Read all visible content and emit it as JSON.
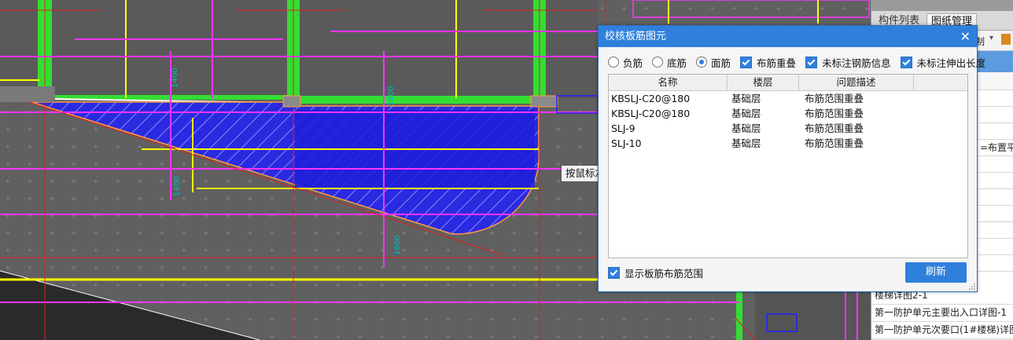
{
  "colors": {
    "cad_background": "#606060",
    "accent": "#2f80dd",
    "rebar_fill": "#2a2ae0",
    "axis_red": "#e02020",
    "beam_yellow": "#ffff00",
    "magenta": "#ff33ff",
    "green_wall": "#33dd33"
  },
  "right_panel": {
    "tabs": [
      "构件列表",
      "图纸管理"
    ],
    "top_fragment": "制",
    "rows": [
      "",
      "",
      "",
      "",
      "",
      "",
      "",
      "",
      "",
      "",
      "",
      "",
      "",
      "",
      "",
      "",
      "楼梯详图2-1",
      "第一防护单元主要出入口详图-1",
      "第一防护单元次要口(1#楼梯)详图"
    ],
    "row_fragment": "=布置平面"
  },
  "dialog": {
    "title": "校核板筋图元",
    "close_symbol": "✕",
    "options": [
      {
        "type": "radio",
        "label": "负筋",
        "checked": false
      },
      {
        "type": "radio",
        "label": "底筋",
        "checked": false
      },
      {
        "type": "radio",
        "label": "面筋",
        "checked": true
      },
      {
        "type": "checkbox",
        "label": "布筋重叠",
        "checked": true
      },
      {
        "type": "checkbox",
        "label": "未标注钢筋信息",
        "checked": true
      },
      {
        "type": "checkbox",
        "label": "未标注伸出长度",
        "checked": true
      }
    ],
    "table": {
      "columns": [
        "名称",
        "楼层",
        "问题描述"
      ],
      "rows": [
        [
          "KBSLJ-C20@180",
          "基础层",
          "布筋范围重叠"
        ],
        [
          "KBSLJ-C20@180",
          "基础层",
          "布筋范围重叠"
        ],
        [
          "SLJ-9",
          "基础层",
          "布筋范围重叠"
        ],
        [
          "SLJ-10",
          "基础层",
          "布筋范围重叠"
        ]
      ]
    },
    "show_range_label": "显示板筋布筋范围",
    "show_range_checked": true,
    "refresh_label": "刷新"
  },
  "tooltip": "按鼠标左键指定第一个角点，或拾取构件图元"
}
